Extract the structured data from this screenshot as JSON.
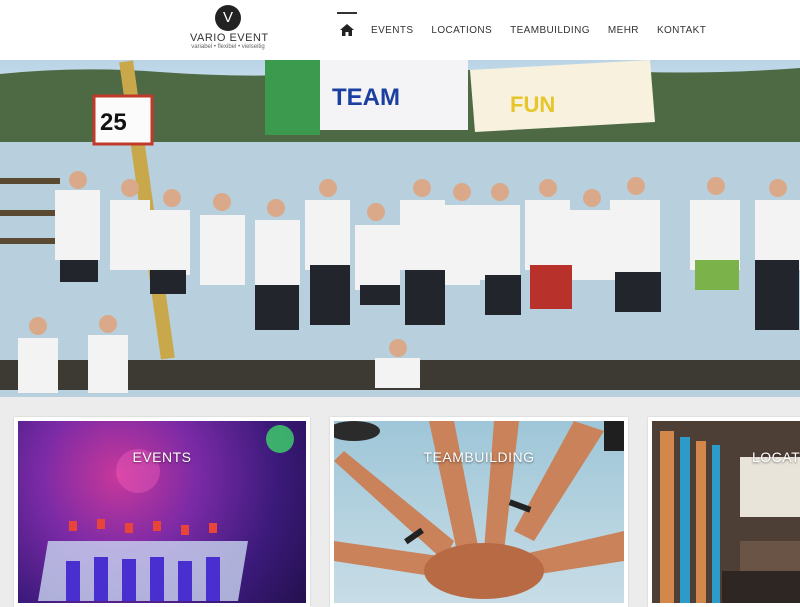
{
  "logo": {
    "mark": "V",
    "title": "VARIO EVENT",
    "tagline": "variabel • flexibel • vielseitig"
  },
  "nav": {
    "home_icon": "home-icon",
    "items": [
      "EVENTS",
      "LOCATIONS",
      "TEAMBUILDING",
      "MEHR",
      "KONTAKT"
    ]
  },
  "hero": {
    "sign_number": "25",
    "banner_text_1": "TEAM",
    "banner_text_2": "FUN"
  },
  "cards": [
    {
      "label": "EVENTS"
    },
    {
      "label": "TEAMBUILDING"
    },
    {
      "label": "LOCAT"
    }
  ],
  "colors": {
    "header_bg": "#ffffff",
    "page_bg": "#ececec",
    "text": "#333333"
  }
}
